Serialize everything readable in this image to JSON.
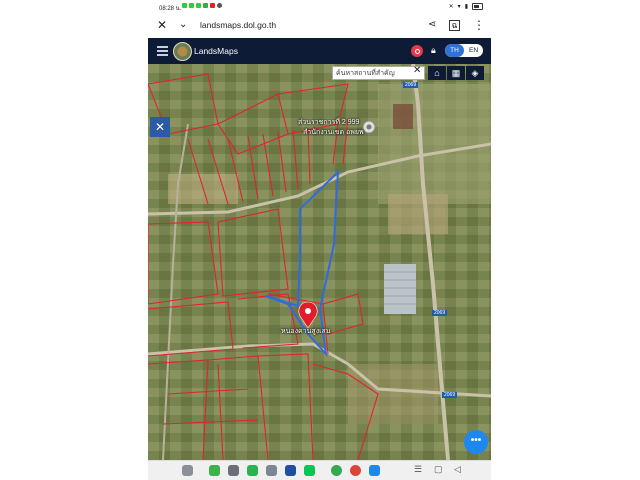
{
  "status_bar": {
    "time": "08:28 น."
  },
  "browser": {
    "url": "landsmaps.dol.go.th"
  },
  "app": {
    "brand": "LandsMaps",
    "lang_th": "TH",
    "lang_en": "EN"
  },
  "map": {
    "search_placeholder": "ค้นหาสถานที่สำคัญ",
    "label_top": "ส่วนราชการที่ 2 999",
    "label_top2": "สำนักงานเขต อพยพ",
    "label_pin": "หนองคานสูงเสม",
    "road_badge_1": "2069",
    "road_badge_2": "2069",
    "road_badge_3": "2069"
  },
  "colors": {
    "header_bg": "#0d1b36",
    "accent": "#2f73d6",
    "parcel_red": "#e0242e",
    "parcel_blue": "#2f6be0",
    "pin": "#e31b2b"
  }
}
